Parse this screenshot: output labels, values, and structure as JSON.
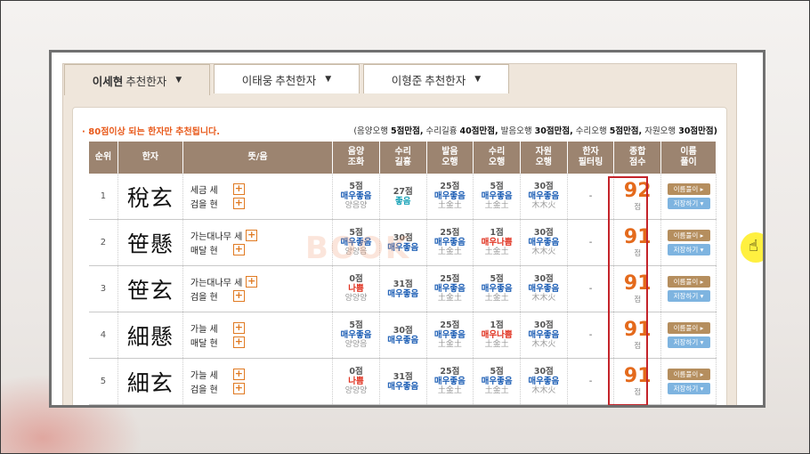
{
  "tabs": [
    {
      "name": "이세현",
      "category": "추천한자",
      "active": true
    },
    {
      "name": "이태웅",
      "category": "추천한자",
      "active": false
    },
    {
      "name": "이형준",
      "category": "추천한자",
      "active": false
    }
  ],
  "notice": "· 80점이상 되는 한자만 추천됩니다.",
  "scoring_parts": [
    {
      "label": "(음양오행",
      "value": "5점만점,"
    },
    {
      "label": "수리길흉",
      "value": "40점만점,"
    },
    {
      "label": "발음오행",
      "value": "30점만점,"
    },
    {
      "label": "수리오행",
      "value": "5점만점,"
    },
    {
      "label": "자원오행",
      "value": "30점만점)"
    }
  ],
  "columns": {
    "rank": "순위",
    "hanja": "한자",
    "meaning": "뜻/음",
    "yinyang_1": "음양",
    "yinyang_2": "조화",
    "suri_1": "수리",
    "suri_2": "길흉",
    "balum_1": "발음",
    "balum_2": "오행",
    "suriohang_1": "수리",
    "suriohang_2": "오행",
    "jawon_1": "자원",
    "jawon_2": "오행",
    "filter_1": "한자",
    "filter_2": "필터링",
    "total_1": "종합",
    "total_2": "점수",
    "name_1": "이름",
    "name_2": "풀이"
  },
  "rows": [
    {
      "rank": "1",
      "hanja": "稅玄",
      "m1": "세금 세",
      "m2": "검을 현",
      "yy_pts": "5점",
      "yy_grade": "매우좋음",
      "yy_el": "양음양",
      "su_pts": "27점",
      "su_grade": "좋음",
      "ba_pts": "25점",
      "ba_grade": "매우좋음",
      "ba_el": "土金土",
      "so_pts": "5점",
      "so_grade": "매우좋음",
      "so_el": "土金土",
      "ja_pts": "30점",
      "ja_grade": "매우좋음",
      "ja_el": "木木火",
      "filter": "-",
      "total": "92",
      "unit": "점",
      "btn_name": "이름풀이 ▸",
      "btn_save": "저장하기 ▾"
    },
    {
      "rank": "2",
      "hanja": "笹懸",
      "m1": "가는대나무 세",
      "m2": "매달 현",
      "yy_pts": "5점",
      "yy_grade": "매우좋음",
      "yy_el": "양양음",
      "su_pts": "30점",
      "su_grade": "매우좋음",
      "ba_pts": "25점",
      "ba_grade": "매우좋음",
      "ba_el": "土金土",
      "so_pts": "1점",
      "so_grade": "매우나쁨",
      "so_el": "土金土",
      "ja_pts": "30점",
      "ja_grade": "매우좋음",
      "ja_el": "木木火",
      "filter": "-",
      "total": "91",
      "unit": "점",
      "btn_name": "이름풀이 ▸",
      "btn_save": "저장하기 ▾"
    },
    {
      "rank": "3",
      "hanja": "笹玄",
      "m1": "가는대나무 세",
      "m2": "검을 현",
      "yy_pts": "0점",
      "yy_grade": "나쁨",
      "yy_el": "양양양",
      "su_pts": "31점",
      "su_grade": "매우좋음",
      "ba_pts": "25점",
      "ba_grade": "매우좋음",
      "ba_el": "土金土",
      "so_pts": "5점",
      "so_grade": "매우좋음",
      "so_el": "土金土",
      "ja_pts": "30점",
      "ja_grade": "매우좋음",
      "ja_el": "木木火",
      "filter": "-",
      "total": "91",
      "unit": "점",
      "btn_name": "이름풀이 ▸",
      "btn_save": "저장하기 ▾"
    },
    {
      "rank": "4",
      "hanja": "細懸",
      "m1": "가늘 세",
      "m2": "매달 현",
      "yy_pts": "5점",
      "yy_grade": "매우좋음",
      "yy_el": "양양음",
      "su_pts": "30점",
      "su_grade": "매우좋음",
      "ba_pts": "25점",
      "ba_grade": "매우좋음",
      "ba_el": "土金土",
      "so_pts": "1점",
      "so_grade": "매우나쁨",
      "so_el": "土金土",
      "ja_pts": "30점",
      "ja_grade": "매우좋음",
      "ja_el": "木木火",
      "filter": "-",
      "total": "91",
      "unit": "점",
      "btn_name": "이름풀이 ▸",
      "btn_save": "저장하기 ▾"
    },
    {
      "rank": "5",
      "hanja": "細玄",
      "m1": "가늘 세",
      "m2": "검을 현",
      "yy_pts": "0점",
      "yy_grade": "나쁨",
      "yy_el": "양양양",
      "su_pts": "31점",
      "su_grade": "매우좋음",
      "ba_pts": "25점",
      "ba_grade": "매우좋음",
      "ba_el": "土金土",
      "so_pts": "5점",
      "so_grade": "매우좋음",
      "so_el": "土金土",
      "ja_pts": "30점",
      "ja_grade": "매우좋음",
      "ja_el": "木木火",
      "filter": "-",
      "total": "91",
      "unit": "점",
      "btn_name": "이름풀이 ▸",
      "btn_save": "저장하기 ▾"
    }
  ],
  "watermark": "BOOK",
  "colors": {
    "accent": "#e46a1c",
    "header_bg": "#9c8470",
    "good": "#1e5fb5",
    "bad": "#e0301e",
    "highlight_box": "#c4242a"
  }
}
